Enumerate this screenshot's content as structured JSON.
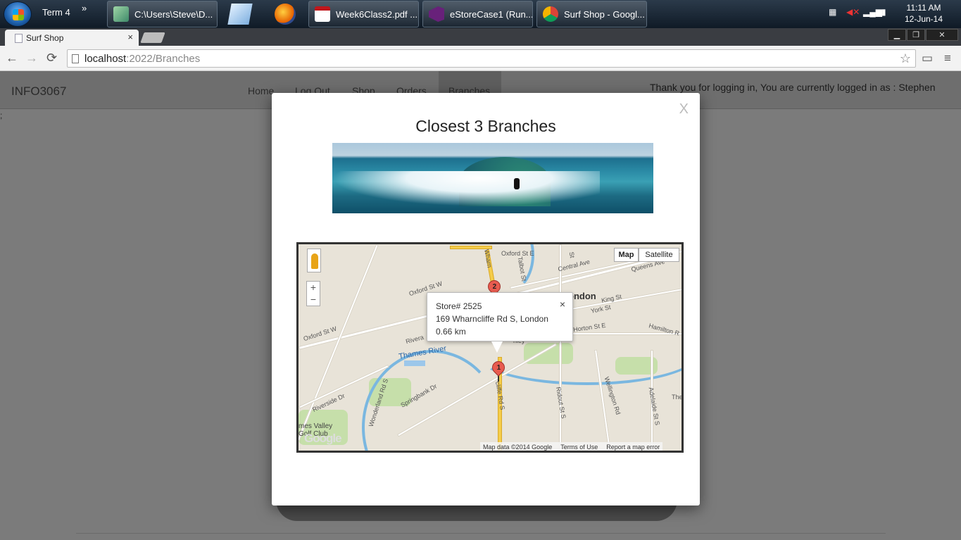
{
  "taskbar": {
    "term_label": "Term 4",
    "overflow": "»",
    "explorer_label": "C:\\Users\\Steve\\D...",
    "pdf_label": "Week6Class2.pdf ...",
    "vs_label": "eStoreCase1 (Run...",
    "chrome_label": "Surf Shop - Googl...",
    "time": "11:11 AM",
    "date": "12-Jun-14"
  },
  "browser": {
    "tab_title": "Surf Shop",
    "tab_close": "×",
    "url_host": "localhost",
    "url_rest": ":2022/Branches",
    "back": "←",
    "forward": "→",
    "reload": "⟳",
    "star": "☆",
    "cast": "▭",
    "menu": "≡",
    "minimize": "▁",
    "restore": "❐",
    "close": "✕"
  },
  "site": {
    "brand": "INFO3067",
    "nav": [
      "Home",
      "Log Out",
      "Shop",
      "Orders",
      "Branches"
    ],
    "active_nav": "Branches",
    "welcome": "Thank you for logging in, You are currently logged in as : Stephen",
    "stray_text": ";"
  },
  "modal": {
    "close": "X",
    "title": "Closest 3 Branches"
  },
  "map": {
    "map_button": "Map",
    "satellite_button": "Satellite",
    "zoom_in": "+",
    "zoom_out": "−",
    "info": {
      "store": "Store# 2525",
      "address": "169 Wharncliffe Rd S, London",
      "distance": "0.66 km",
      "close": "×"
    },
    "markers": [
      "1",
      "2"
    ],
    "labels": {
      "london": "ondon",
      "oxford_st_e": "Oxford St E",
      "oxford_st_w": "Oxford St W",
      "oxford_st_w2": "Oxford St W",
      "central_ave": "Central Ave",
      "queens_ave": "Queens Ave",
      "king_st": "King St",
      "york_st": "York St",
      "horton_st_e": "Horton St E",
      "hamilton_rd": "Hamilton R",
      "thames_river": "Thames River",
      "riverside_dr": "Riverside Dr",
      "springbank_dr": "Springbank Dr",
      "wonderland_rd_s": "Wonderland Rd S",
      "ridout_st_s": "Ridout St S",
      "wellington_rd": "Wellington Rd",
      "adelaide_st_s": "Adelaide St S",
      "wharncliffe": "cliffe Rd S",
      "whar": "Wharn",
      "talbot": "Talbot St",
      "golf_club": "mes Valley Golf Club",
      "rivera": "Rivera",
      "stanley": "nley",
      "the": "The",
      "st": "St"
    },
    "attribution": [
      "Map data ©2014 Google",
      "Terms of Use",
      "Report a map error"
    ],
    "google_logo": "Google"
  }
}
